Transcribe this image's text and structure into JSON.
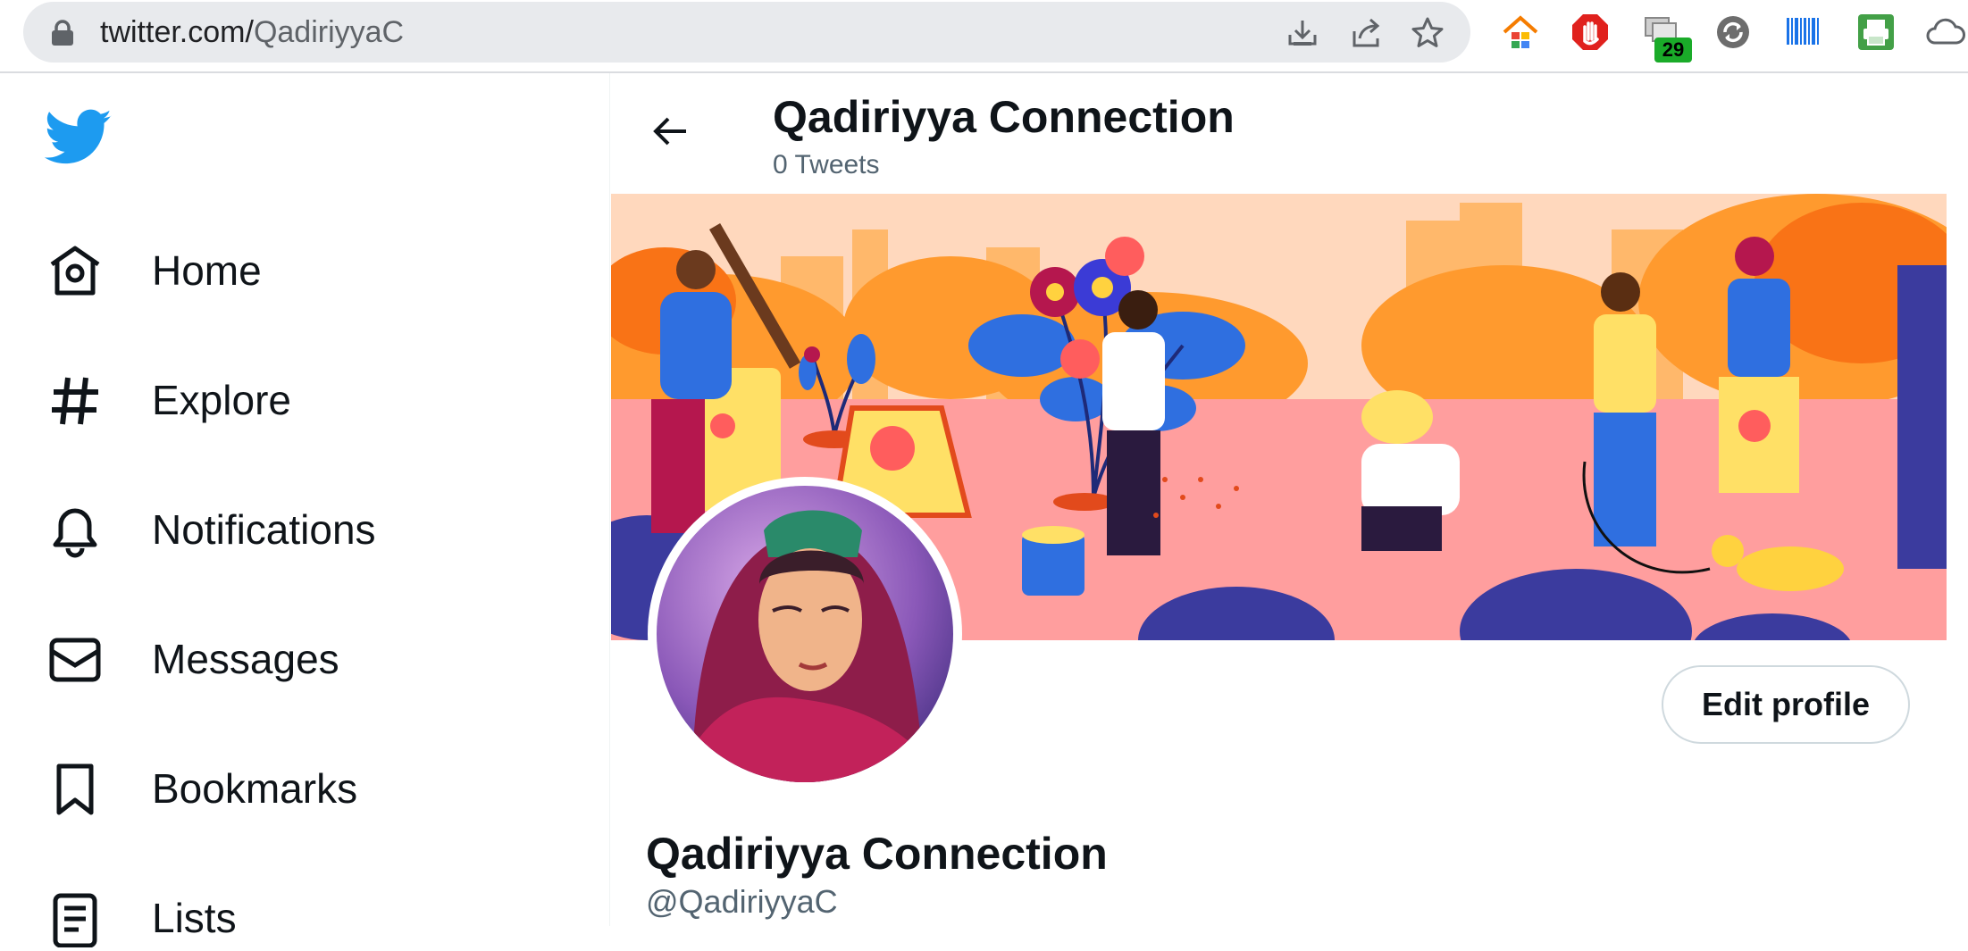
{
  "browser": {
    "url_host": "twitter.com/",
    "url_path": "QadiriyyaC",
    "omnibox_icons": [
      "download-icon",
      "share-icon",
      "bookmark-star-icon"
    ],
    "extensions": [
      {
        "name": "home-extension-icon"
      },
      {
        "name": "stop-hand-extension-icon"
      },
      {
        "name": "tabs-extension-icon",
        "badge": "29"
      },
      {
        "name": "sync-extension-icon"
      },
      {
        "name": "barcode-extension-icon"
      },
      {
        "name": "print-extension-icon"
      },
      {
        "name": "cloud-extension-icon"
      }
    ]
  },
  "sidebar": {
    "logo": "twitter-bird-icon",
    "items": [
      {
        "label": "Home",
        "icon": "home-icon"
      },
      {
        "label": "Explore",
        "icon": "hashtag-icon"
      },
      {
        "label": "Notifications",
        "icon": "bell-icon"
      },
      {
        "label": "Messages",
        "icon": "envelope-icon"
      },
      {
        "label": "Bookmarks",
        "icon": "bookmark-icon"
      },
      {
        "label": "Lists",
        "icon": "list-icon"
      }
    ]
  },
  "header": {
    "title": "Qadiriyya Connection",
    "tweet_count": "0 Tweets"
  },
  "profile": {
    "name": "Qadiriyya Connection",
    "handle": "@QadiriyyaC",
    "edit_label": "Edit profile"
  },
  "colors": {
    "twitter_blue": "#1d9bf0",
    "text_primary": "#0f1419",
    "text_secondary": "#536471",
    "badge_green": "#1aab29"
  }
}
